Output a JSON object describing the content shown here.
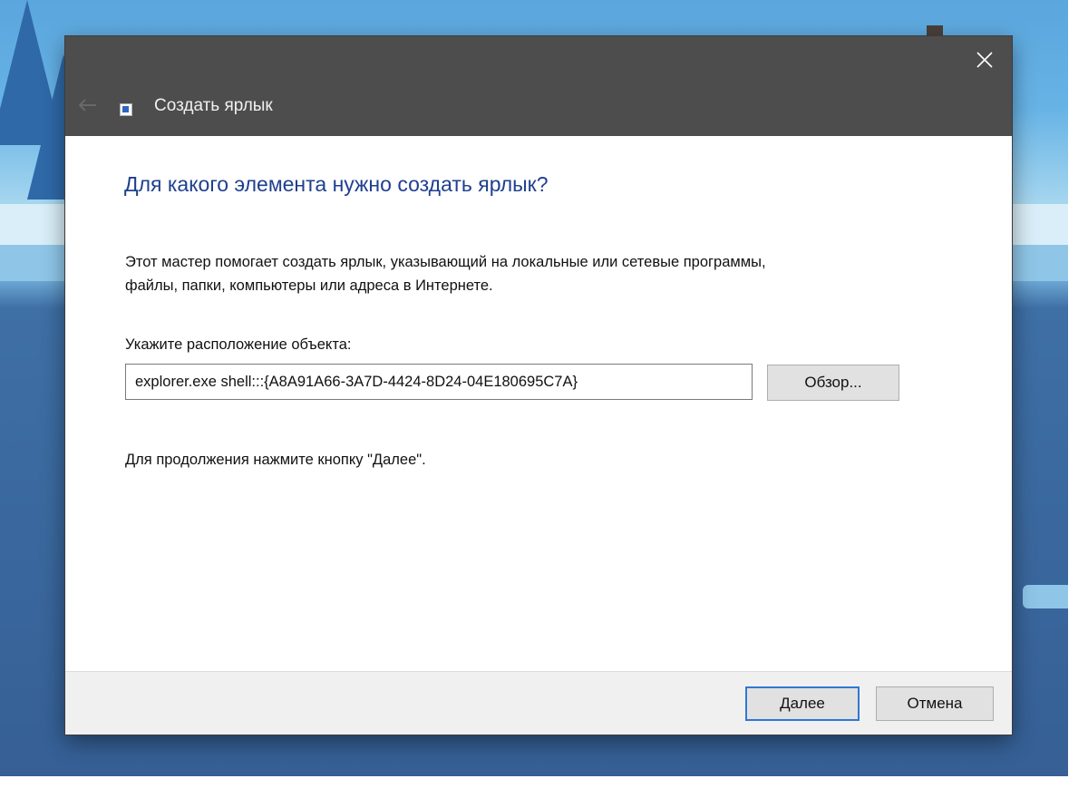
{
  "window": {
    "title": "Создать ярлык",
    "colors": {
      "titlebar": "#4d4d4d",
      "heading": "#1f3f8f",
      "focus_border": "#2e78d4"
    }
  },
  "icons": {
    "close": "close-icon",
    "back": "back-arrow-icon",
    "app": "shortcut-icon"
  },
  "main": {
    "heading": "Для какого элемента нужно создать ярлык?",
    "intro_line1": "Этот мастер помогает создать ярлык, указывающий на локальные или сетевые программы,",
    "intro_line2": "файлы, папки, компьютеры или адреса в Интернете.",
    "location_label": "Укажите расположение объекта:",
    "location_value": "explorer.exe shell:::{A8A91A66-3A7D-4424-8D24-04E180695C7A}",
    "browse_label": "Обзор...",
    "hint": "Для продолжения нажмите кнопку \"Далее\"."
  },
  "footer": {
    "next_label": "Далее",
    "cancel_label": "Отмена"
  }
}
